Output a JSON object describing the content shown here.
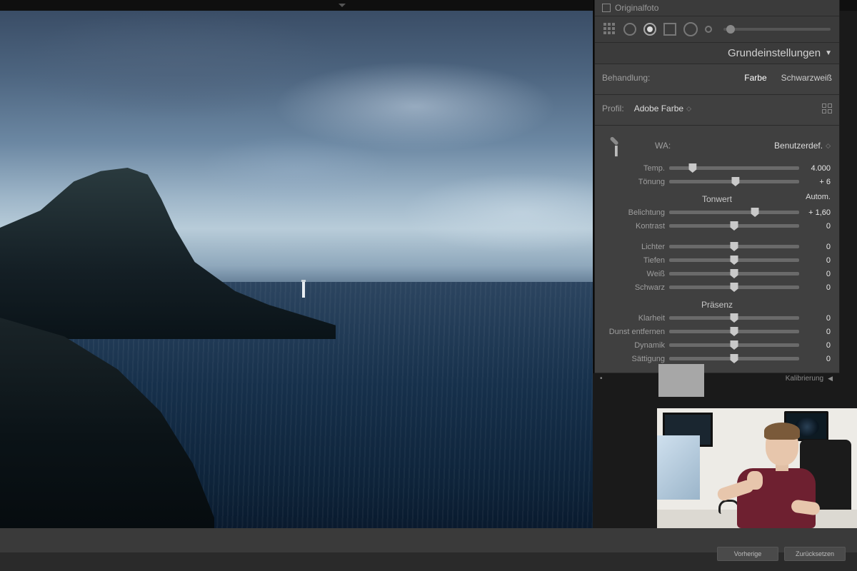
{
  "histogram": {
    "original_label": "Originalfoto"
  },
  "basic_panel": {
    "title": "Grundeinstellungen",
    "treatment_label": "Behandlung:",
    "treatment_options": {
      "color": "Farbe",
      "bw": "Schwarzweiß"
    },
    "profile_label": "Profil:",
    "profile_value": "Adobe Farbe",
    "wb_label": "WA:",
    "wb_value": "Benutzerdef.",
    "sliders": {
      "temp": {
        "label": "Temp.",
        "value": "4.000",
        "pos": 18
      },
      "tint": {
        "label": "Tönung",
        "value": "+ 6",
        "pos": 51
      },
      "tone_title": "Tonwert",
      "auto": "Autom.",
      "exposure": {
        "label": "Belichtung",
        "value": "+ 1,60",
        "pos": 66
      },
      "contrast": {
        "label": "Kontrast",
        "value": "0",
        "pos": 50
      },
      "highlights": {
        "label": "Lichter",
        "value": "0",
        "pos": 50
      },
      "shadows": {
        "label": "Tiefen",
        "value": "0",
        "pos": 50
      },
      "whites": {
        "label": "Weiß",
        "value": "0",
        "pos": 50
      },
      "blacks": {
        "label": "Schwarz",
        "value": "0",
        "pos": 50
      },
      "presence_title": "Präsenz",
      "clarity": {
        "label": "Klarheit",
        "value": "0",
        "pos": 50
      },
      "dehaze": {
        "label": "Dunst entfernen",
        "value": "0",
        "pos": 50
      },
      "vibrance": {
        "label": "Dynamik",
        "value": "0",
        "pos": 50
      },
      "saturation": {
        "label": "Sättigung",
        "value": "0",
        "pos": 50
      }
    }
  },
  "calibration_label": "Kalibrierung",
  "footer": {
    "prev": "Vorherige",
    "reset": "Zurücksetzen"
  }
}
